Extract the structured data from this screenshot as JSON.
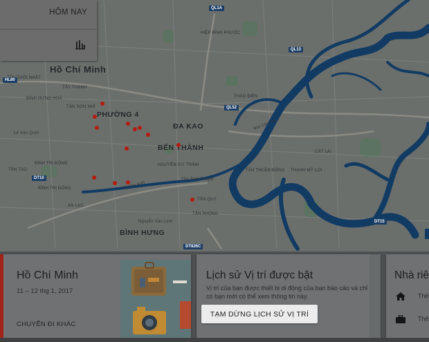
{
  "date_panel": {
    "today_label": "HÔM NAY",
    "chart_icon": "bar-chart-icon"
  },
  "map": {
    "city_label": "Hồ Chí Minh",
    "districts": [
      {
        "key": "phuong4",
        "text": "PHƯỜNG 4"
      },
      {
        "key": "dakao",
        "text": "ĐA KAO"
      },
      {
        "key": "benthanh",
        "text": "BẾN THÀNH"
      },
      {
        "key": "binhhung",
        "text": "BÌNH HƯNG"
      }
    ],
    "small_labels": [
      "HIỆP BÌNH PHƯỚC",
      "TÂY THẠNH",
      "BÌNH HƯNG HOÀ",
      "TÂN SƠN NHÌ",
      "TÂN THỚI NHẤT",
      "THẢO ĐIỀN",
      "NGUYỄN CƯ TRINH",
      "BÌNH TRỊ ĐÔNG",
      "TÂN THUẬN ĐÔNG",
      "THẠNH MỸ LỢI",
      "CÁT LÁI",
      "TÂN PHONG",
      "TÂN QUY",
      "BÌNH TRỊ ĐÔNG",
      "AN LẠC",
      "TÂN TẠO"
    ],
    "road_labels": [
      "Võ Văn Kiệt",
      "Mai Chí Thọ",
      "Nguyễn Văn Linh",
      "Tôn Thất Thuyết",
      "Lê Văn Quới"
    ],
    "highway_shields": [
      "QL1A",
      "QL13",
      "QL52",
      "HL80",
      "DT10",
      "DT15",
      "DT826C"
    ],
    "trash_icon": "trash-icon"
  },
  "cards": {
    "trip": {
      "title": "Hồ Chí Minh",
      "dates": "11 – 12 thg 1, 2017",
      "other_trips": "CHUYẾN ĐI KHÁC"
    },
    "history": {
      "title": "Lịch sử Vị trí được bật",
      "description": "Vị trí của bạn được thiết bị di động của bạn báo cáo và chỉ có bạn mới có thể xem thông tin này.",
      "pause_button": "TẠM DỪNG LỊCH SỬ VỊ TRÍ"
    },
    "places": {
      "title": "Nhà riêng",
      "rows": [
        {
          "icon": "home-icon",
          "text": "Thê"
        },
        {
          "icon": "briefcase-icon",
          "text": "Thê"
        }
      ]
    }
  },
  "colors": {
    "accent_red": "#a3231b",
    "dot_red": "#b21d10",
    "river_blue": "#123b63",
    "overlay_gray": "#6f7173"
  }
}
